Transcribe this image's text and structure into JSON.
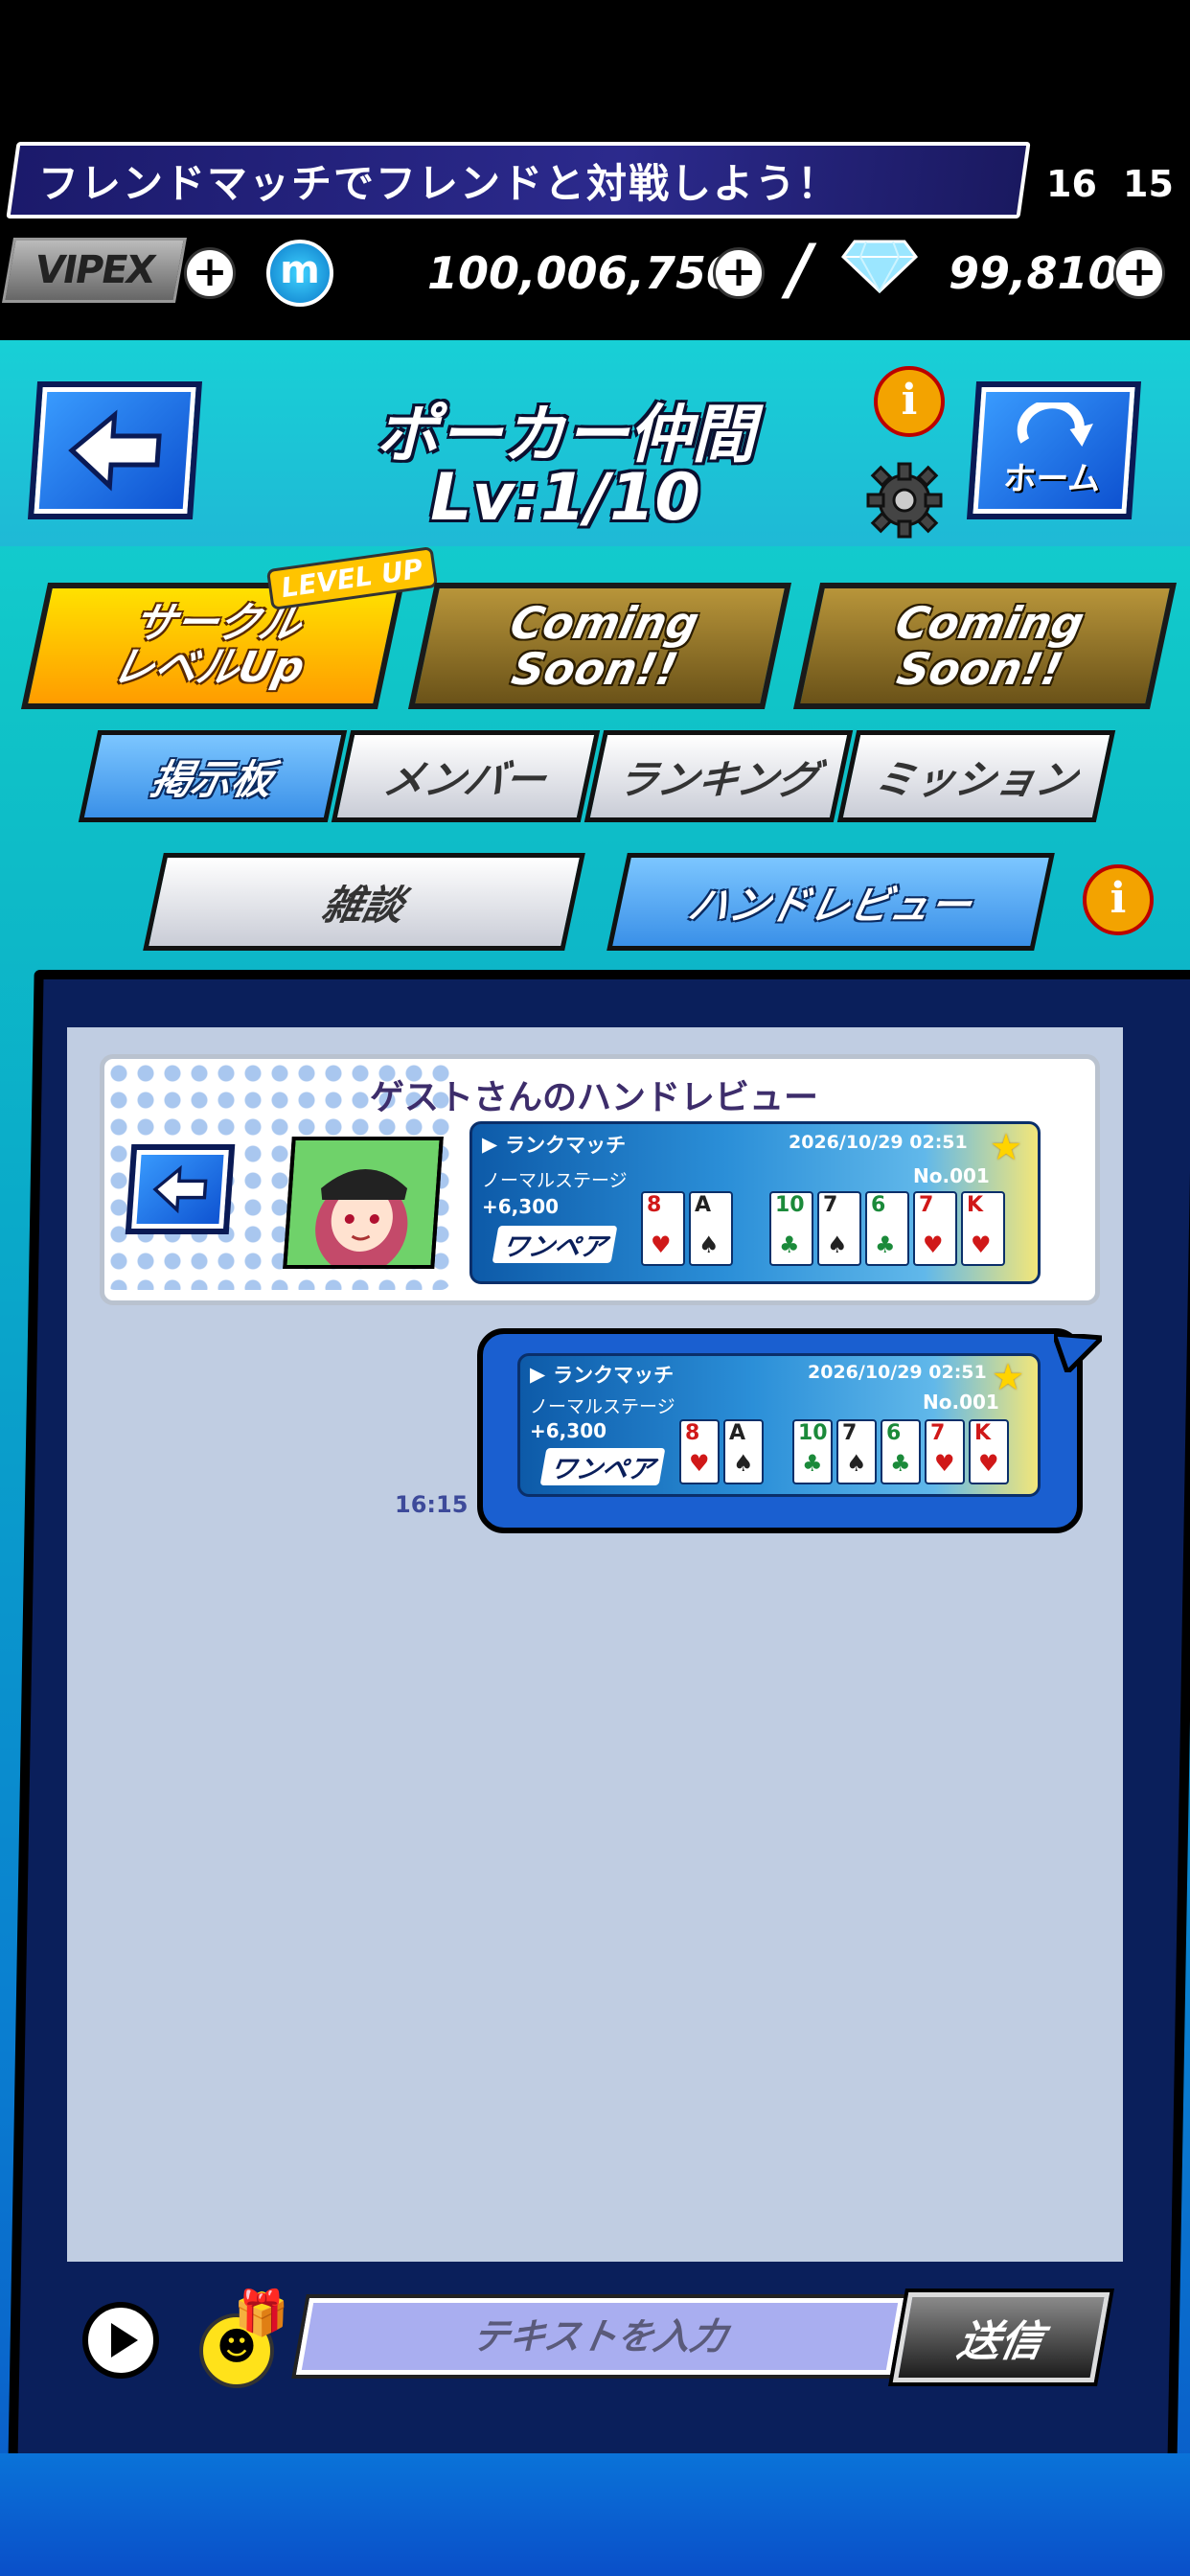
{
  "status": {
    "ticker": "フレンドマッチでフレンドと対戦しよう！",
    "clock_left": "16",
    "clock_right": "15"
  },
  "currency": {
    "vip_badge": "VIPEX",
    "m_coin_label": "m",
    "coins": "100,006,750",
    "gems": "99,810",
    "separator": "/"
  },
  "header": {
    "title": "ポーカー仲間",
    "level": "Lv:1/10",
    "home_label": "ホーム"
  },
  "actions": {
    "circle_levelup": "サークル\nレベルUp",
    "levelup_badge": "LEVEL UP",
    "coming_soon_1": "Coming\nSoon!!",
    "coming_soon_2": "Coming\nSoon!!"
  },
  "tabs": [
    {
      "label": "掲示板",
      "active": true
    },
    {
      "label": "メンバー",
      "active": false
    },
    {
      "label": "ランキング",
      "active": false
    },
    {
      "label": "ミッション",
      "active": false
    }
  ],
  "subtabs": [
    {
      "label": "雑談",
      "active": false
    },
    {
      "label": "ハンドレビュー",
      "active": true
    }
  ],
  "review": {
    "title": "ゲストさんのハンドレビュー"
  },
  "hand": {
    "mode": "ランクマッチ",
    "date": "2026/10/29 02:51",
    "stage": "ノーマルステージ",
    "number": "No.001",
    "chips": "+6,300",
    "rank": "ワンペア",
    "hole_cards": [
      {
        "rank": "8",
        "suit": "♥",
        "color": "red"
      },
      {
        "rank": "A",
        "suit": "♠",
        "color": "black"
      }
    ],
    "board_cards": [
      {
        "rank": "10",
        "suit": "♣",
        "color": "green"
      },
      {
        "rank": "7",
        "suit": "♠",
        "color": "black"
      },
      {
        "rank": "6",
        "suit": "♣",
        "color": "green"
      },
      {
        "rank": "7",
        "suit": "♥",
        "color": "red"
      },
      {
        "rank": "K",
        "suit": "♥",
        "color": "red"
      }
    ]
  },
  "message": {
    "time": "16:15"
  },
  "input": {
    "placeholder": "テキストを入力",
    "send_label": "送信"
  },
  "icons": {
    "info": "info-icon",
    "gear": "gear-icon",
    "back": "back-arrow-icon",
    "home": "home-icon",
    "play": "play-icon",
    "emoji": "smiley-icon",
    "gift": "gift-icon",
    "star": "star-icon",
    "gem": "diamond-icon"
  }
}
